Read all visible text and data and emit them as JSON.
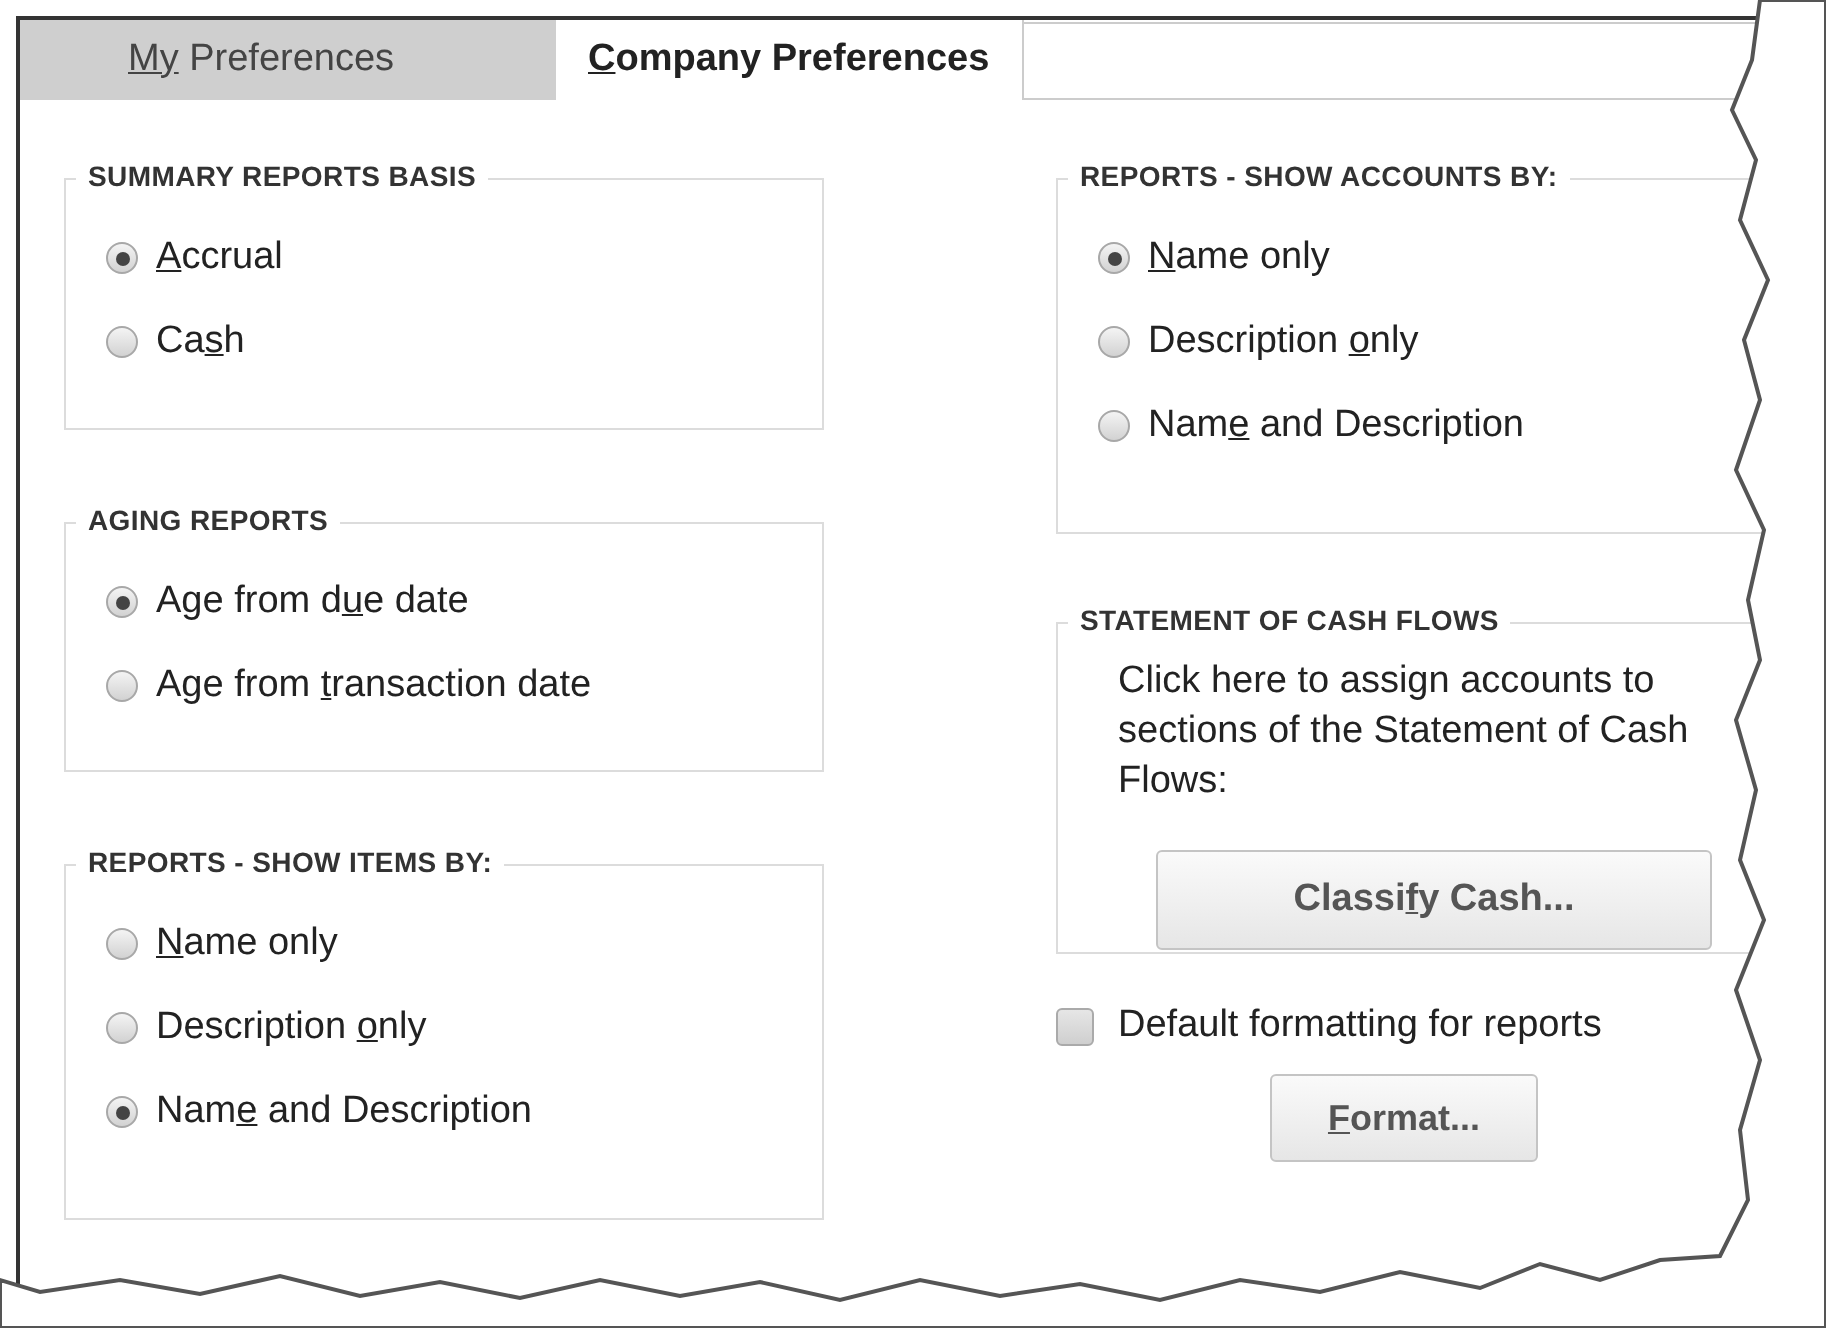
{
  "tabs": [
    {
      "label": {
        "access_key": "My",
        "text_after": " Preferences"
      },
      "selected": false
    },
    {
      "label": {
        "access_key": "C",
        "text_after": "ompany Preferences"
      },
      "selected": true
    }
  ],
  "left_groups": [
    {
      "kind": "options",
      "title": "SUMMARY REPORTS BASIS",
      "options": [
        {
          "label": {
            "access_key": "A",
            "text_after": "ccrual"
          },
          "selected": true
        },
        {
          "label": {
            "text_before": "Ca",
            "access_key": "s",
            "text_after": "h"
          },
          "selected": false
        }
      ]
    },
    {
      "kind": "options",
      "title": "AGING REPORTS",
      "options": [
        {
          "label": {
            "text_before": "Age from d",
            "access_key": "u",
            "text_after": "e date"
          },
          "selected": true
        },
        {
          "label": {
            "text_before": "Age from ",
            "access_key": "t",
            "text_after": "ransaction date"
          },
          "selected": false
        }
      ]
    },
    {
      "kind": "options",
      "title": "REPORTS - SHOW ITEMS BY:",
      "options": [
        {
          "label": {
            "access_key": "N",
            "text_after": "ame only"
          },
          "selected": false
        },
        {
          "label": {
            "text_before": "Description ",
            "access_key": "o",
            "text_after": "nly"
          },
          "selected": false
        },
        {
          "label": {
            "text_before": "Nam",
            "access_key": "e",
            "text_after": " and Description"
          },
          "selected": true
        }
      ]
    }
  ],
  "right_groups": [
    {
      "kind": "options",
      "title": "REPORTS -  SHOW ACCOUNTS BY:",
      "options": [
        {
          "label": {
            "access_key": "N",
            "text_after": "ame only"
          },
          "selected": true
        },
        {
          "label": {
            "text_before": "Description ",
            "access_key": "o",
            "text_after": "nly"
          },
          "selected": false
        },
        {
          "label": {
            "text_before": "Nam",
            "access_key": "e",
            "text_after": " and Description"
          },
          "selected": false
        }
      ]
    },
    {
      "kind": "action",
      "title": "STATEMENT OF CASH FLOWS",
      "text": "Click here to assign accounts to sections of the Statement of Cash Flows:",
      "button": {
        "text_before": "Classi",
        "access_key": "f",
        "text_after": "y Cash..."
      }
    }
  ],
  "default_formatting": {
    "label": "Default formatting for reports",
    "checked": false
  },
  "format_button": {
    "access_key": "F",
    "text_after": "ormat..."
  }
}
